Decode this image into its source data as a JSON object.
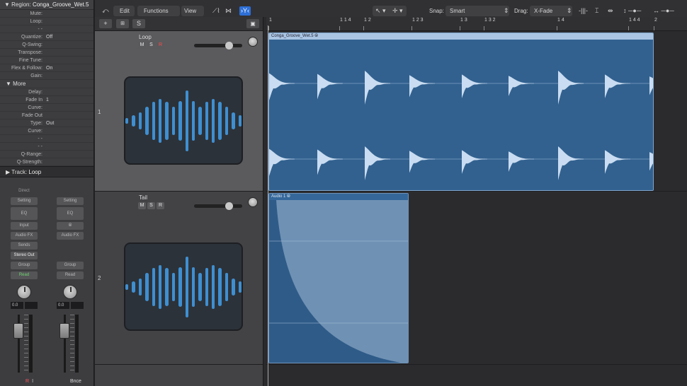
{
  "inspector": {
    "region_label": "Region:",
    "region_name": "Conga_Groove_Wet.5",
    "params": [
      {
        "k": "Mute:",
        "v": ""
      },
      {
        "k": "Loop:",
        "v": ""
      },
      {
        "k": "-  -",
        "v": ""
      },
      {
        "k": "Quantize:",
        "v": "Off"
      },
      {
        "k": "Q-Swing:",
        "v": ""
      },
      {
        "k": "Transpose:",
        "v": ""
      },
      {
        "k": "Fine Tune:",
        "v": ""
      },
      {
        "k": "Flex & Follow:",
        "v": "On"
      },
      {
        "k": "Gain:",
        "v": ""
      }
    ],
    "more_label": "More",
    "more_params": [
      {
        "k": "Delay:",
        "v": ""
      },
      {
        "k": "Fade In",
        "v": "1"
      },
      {
        "k": "Curve:",
        "v": ""
      },
      {
        "k": "Fade Out",
        "v": ""
      },
      {
        "k": "Type:",
        "v": "Out"
      },
      {
        "k": "Curve:",
        "v": ""
      },
      {
        "k": "-  -",
        "v": ""
      },
      {
        "k": "-  -",
        "v": ""
      },
      {
        "k": "Q-Range:",
        "v": ""
      },
      {
        "k": "Q-Strength:",
        "v": ""
      }
    ],
    "track_label": "Track:",
    "track_name": "Loop",
    "strip_left": {
      "direct": "Direct",
      "setting": "Setting",
      "eq": "EQ",
      "input": "Input",
      "audio_fx": "Audio FX",
      "sends": "Sends",
      "output": "Stereo Out",
      "group": "Group",
      "automation": "Read",
      "vol": "0.0",
      "rec": "R",
      "inp": "I"
    },
    "strip_right": {
      "setting": "Setting",
      "eq": "EQ",
      "audio_fx": "Audio FX",
      "group": "Group",
      "automation": "Read",
      "vol": "0.0",
      "name": "Bnce"
    }
  },
  "toolbar": {
    "edit": "Edit",
    "functions": "Functions",
    "view": "View",
    "snap_label": "Snap:",
    "snap_value": "Smart",
    "drag_label": "Drag:",
    "drag_value": "X-Fade"
  },
  "ruler": [
    "1",
    "1 1 4",
    "1 2",
    "1 2 3",
    "1 3",
    "1 3 2",
    "1 4",
    "1 4 4",
    "2"
  ],
  "tracks": [
    {
      "num": "1",
      "name": "Loop",
      "m": "M",
      "s": "S",
      "r": "R"
    },
    {
      "num": "2",
      "name": "Tail",
      "m": "M",
      "s": "S",
      "r": "R"
    }
  ],
  "regions": [
    {
      "name": "Conga_Groove_Wet.5",
      "color": "#3c6a98"
    },
    {
      "name": "Audio 1",
      "color": "#3c6a98"
    }
  ],
  "header_buttons": {
    "add": "+",
    "solo": "S"
  }
}
